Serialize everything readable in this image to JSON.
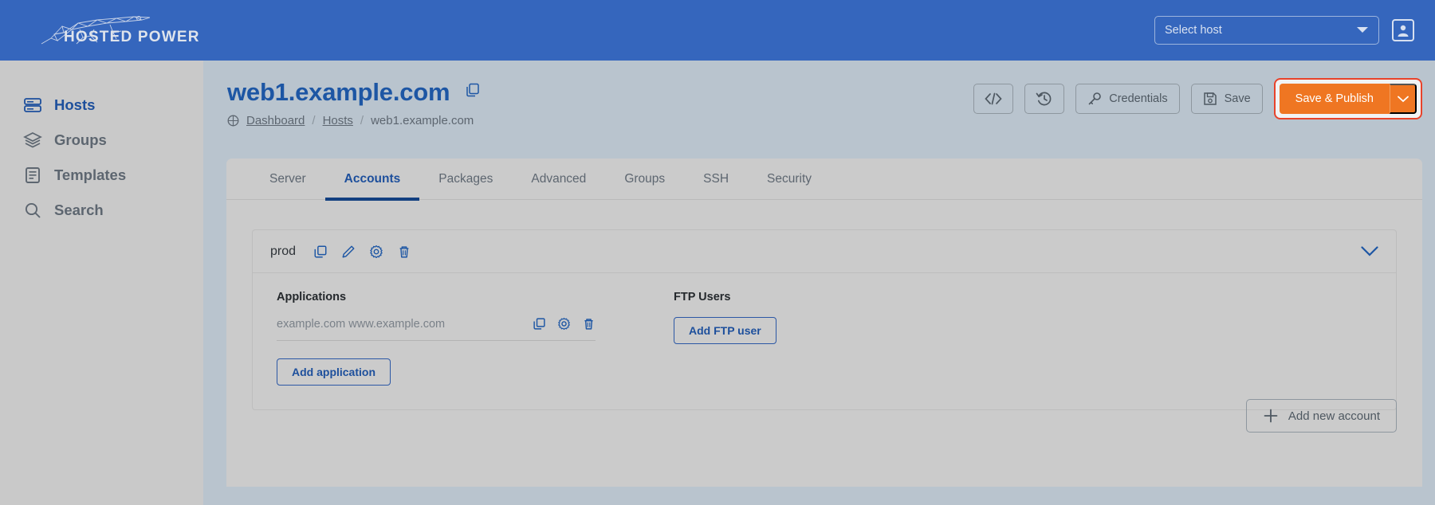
{
  "topbar": {
    "brand": "HOSTED POWER",
    "logo_icon": "cheetah-logo-icon",
    "host_select": {
      "value": "Select host",
      "caret_icon": "chevron-down-icon"
    },
    "user_icon": "user-account-icon"
  },
  "sidebar": {
    "items": [
      {
        "label": "Hosts",
        "icon": "server-rack-icon",
        "active": true
      },
      {
        "label": "Groups",
        "icon": "layers-icon",
        "active": false
      },
      {
        "label": "Templates",
        "icon": "document-list-icon",
        "active": false
      },
      {
        "label": "Search",
        "icon": "magnifier-icon",
        "active": false
      }
    ]
  },
  "page": {
    "title": "web1.example.com",
    "title_copy_icon": "copy-icon",
    "breadcrumb": {
      "home_icon": "dashboard-globe-icon",
      "items": [
        {
          "label": "Dashboard",
          "link": true
        },
        {
          "label": "Hosts",
          "link": true
        },
        {
          "label": "web1.example.com",
          "link": false
        }
      ],
      "separator": "/"
    }
  },
  "actions": {
    "code_button": {
      "label": "",
      "icon": "code-brackets-icon"
    },
    "history_button": {
      "label": "",
      "icon": "history-clock-icon"
    },
    "credentials_button": {
      "label": "Credentials",
      "icon": "key-icon"
    },
    "save_button": {
      "label": "Save",
      "icon": "floppy-disk-icon"
    },
    "publish_button": {
      "label": "Save & Publish",
      "caret_icon": "chevron-down-icon"
    },
    "highlight_color": "#e8422a",
    "publish_color": "#ef7622"
  },
  "tabs": [
    {
      "label": "Server",
      "active": false
    },
    {
      "label": "Accounts",
      "active": true
    },
    {
      "label": "Packages",
      "active": false
    },
    {
      "label": "Advanced",
      "active": false
    },
    {
      "label": "Groups",
      "active": false
    },
    {
      "label": "SSH",
      "active": false
    },
    {
      "label": "Security",
      "active": false
    }
  ],
  "account": {
    "name": "prod",
    "header_icons": [
      "copy-icon",
      "pencil-edit-icon",
      "gear-icon",
      "trash-icon"
    ],
    "collapse_icon": "chevron-down-icon",
    "applications": {
      "title": "Applications",
      "rows": [
        {
          "name": "example.com www.example.com",
          "icons": [
            "copy-icon",
            "gear-icon",
            "trash-icon"
          ]
        }
      ],
      "add_label": "Add application"
    },
    "ftp_users": {
      "title": "FTP Users",
      "add_label": "Add FTP user"
    }
  },
  "footer": {
    "add_account_label": "Add new account",
    "add_account_icon": "plus-icon"
  },
  "colors": {
    "header_blue": "#3566bd",
    "accent_blue": "#1d4f9c",
    "page_bg": "#b9c4ce",
    "card_bg": "#cbcbcb",
    "sidebar_bg": "#c9c9c9"
  }
}
